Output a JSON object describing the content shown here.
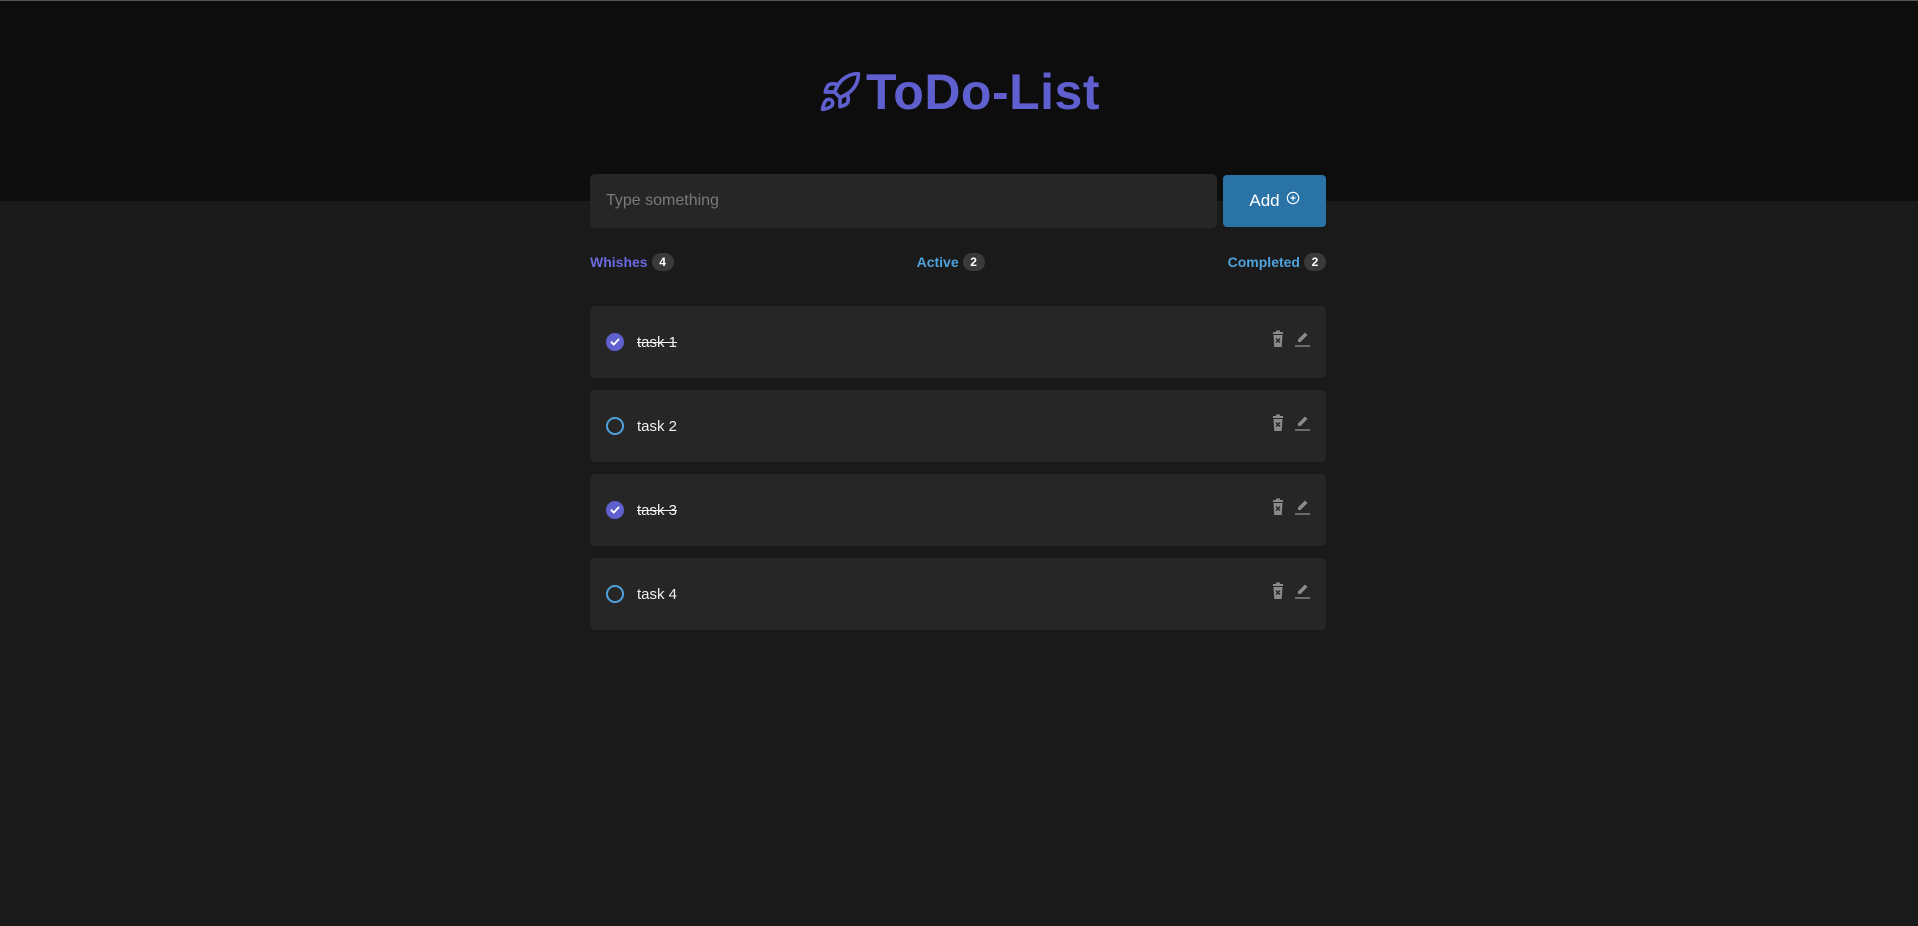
{
  "header": {
    "title": "ToDo-List",
    "icon": "rocket-icon",
    "title_color": "#5f5fd0"
  },
  "input": {
    "placeholder": "Type something",
    "value": ""
  },
  "add_button": {
    "label": "Add",
    "icon": "plus-circle-icon"
  },
  "filters": [
    {
      "label": "Whishes",
      "count": "4"
    },
    {
      "label": "Active",
      "count": "2"
    },
    {
      "label": "Completed",
      "count": "2"
    }
  ],
  "tasks": [
    {
      "label": "task 1",
      "completed": true
    },
    {
      "label": "task 2",
      "completed": false
    },
    {
      "label": "task 3",
      "completed": true
    },
    {
      "label": "task 4",
      "completed": false
    }
  ],
  "colors": {
    "accent": "#5f5fd0",
    "button": "#2a73a6",
    "link": "#4fa3dc"
  }
}
